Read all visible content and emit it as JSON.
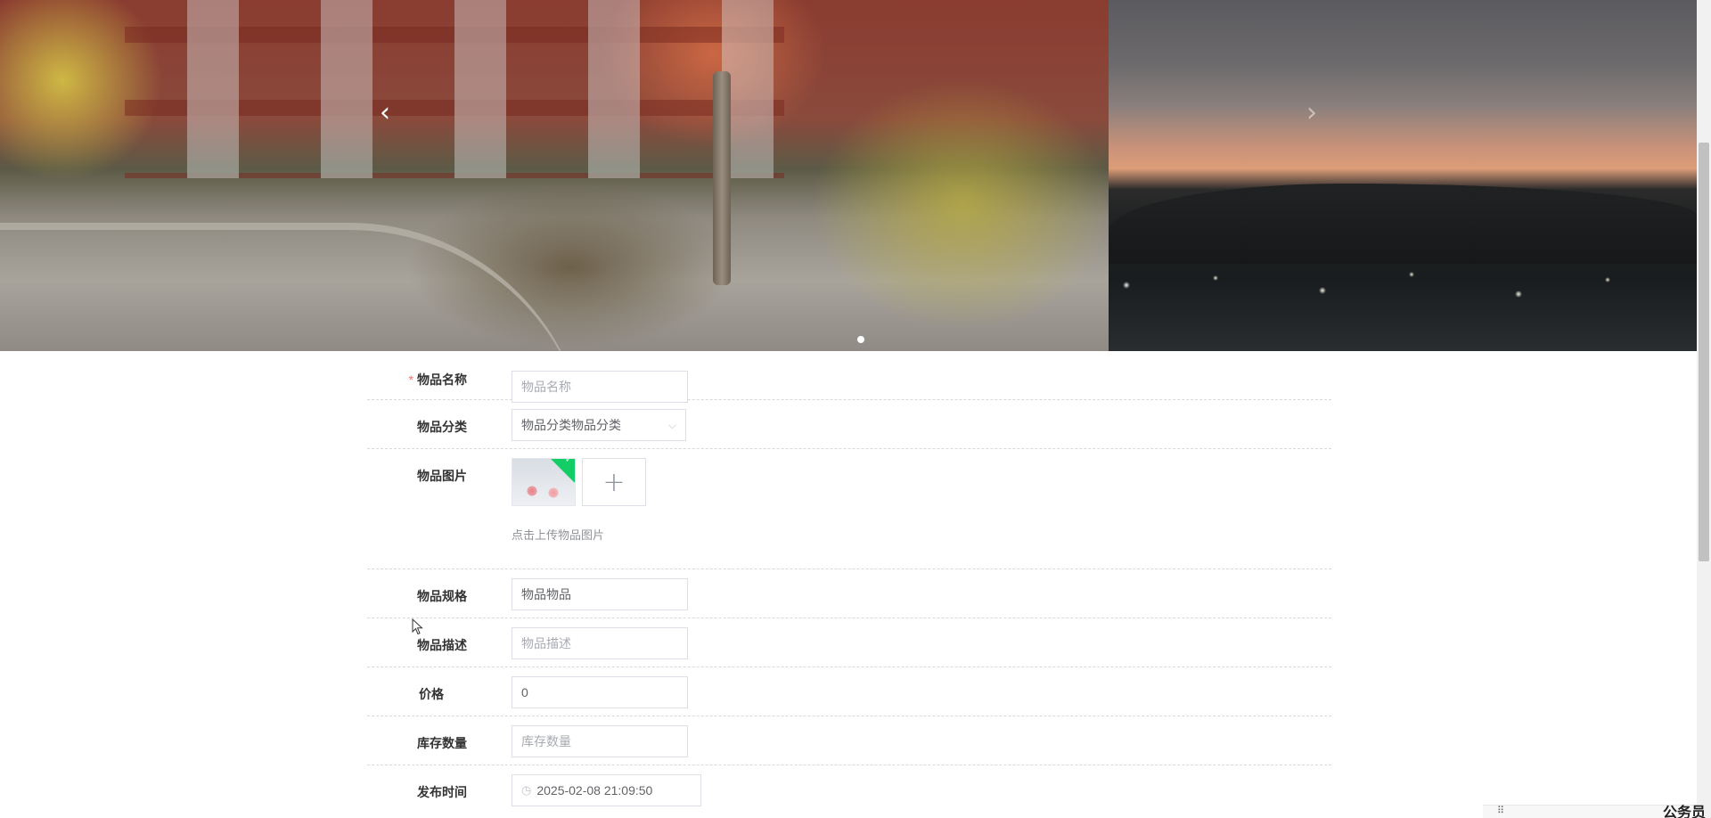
{
  "carousel": {
    "prev_icon": "chevron-left-icon",
    "next_icon": "chevron-right-icon",
    "prev_glyph": "‹",
    "next_glyph": "›",
    "active_index": 0,
    "slide_count": 1
  },
  "form": {
    "name": {
      "label": "物品名称",
      "required_mark": "*",
      "placeholder": "物品名称",
      "value": ""
    },
    "category": {
      "label": "物品分类",
      "value": "物品分类物品分类",
      "caret_glyph": "⌵"
    },
    "image": {
      "label": "物品图片",
      "add_glyph": "+",
      "check_glyph": "✓",
      "tip": "点击上传物品图片"
    },
    "spec": {
      "label": "物品规格",
      "value": "物品物品"
    },
    "description": {
      "label": "物品描述",
      "placeholder": "物品描述",
      "value": ""
    },
    "price": {
      "label": "价格",
      "value": "0"
    },
    "stock": {
      "label": "库存数量",
      "placeholder": "库存数量",
      "value": ""
    },
    "publish_time": {
      "label": "发布时间",
      "clock_glyph": "◷",
      "value": "2025-02-08 21:09:50"
    }
  },
  "footer_fragment": {
    "handle_glyph": "⠿",
    "text": "公务员"
  },
  "colors": {
    "required": "#f56c6c",
    "upload_success": "#13ce66",
    "border": "#dcdfe6",
    "divider": "#d9d9d9"
  }
}
